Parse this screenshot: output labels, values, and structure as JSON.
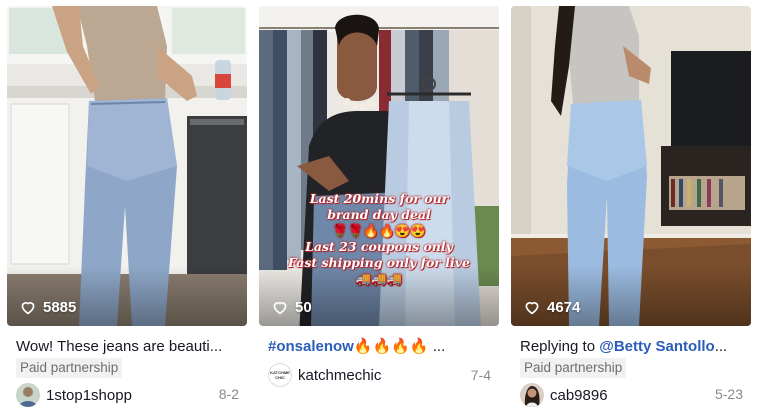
{
  "feed": {
    "cards": [
      {
        "likes": "5885",
        "title": "Wow! These jeans are beauti",
        "title_suffix": "...",
        "badge": "Paid partnership",
        "author": "1stop1shopp",
        "date": "8-2"
      },
      {
        "likes": "50",
        "title_tag": "#onsalenow",
        "title_emoji": "🔥🔥🔥🔥",
        "title_suffix": " ...",
        "author": "katchmechic",
        "avatar_text": "KATCHME CHIC",
        "date": "7-4",
        "overlay": {
          "line1": "Last 20mins for our",
          "line2": "brand day deal",
          "line3": "🌹🌹🔥🔥😍😍",
          "line4": "Last 23 coupons only",
          "line5": "Fast shipping only for live",
          "line6": "🚚🚚🚚"
        }
      },
      {
        "likes": "4674",
        "title": "Replying to ",
        "title_mention": "@Betty Santollo",
        "title_suffix": "...",
        "badge": "Paid partnership",
        "author": "cab9896",
        "date": "5-23"
      }
    ]
  },
  "icons": {
    "like": "heart-outline-icon"
  },
  "colors": {
    "mention": "#2b5db9",
    "muted": "#8a8b91",
    "badge_bg": "#f1f1f2",
    "overlay_outline": "#b3262d"
  }
}
